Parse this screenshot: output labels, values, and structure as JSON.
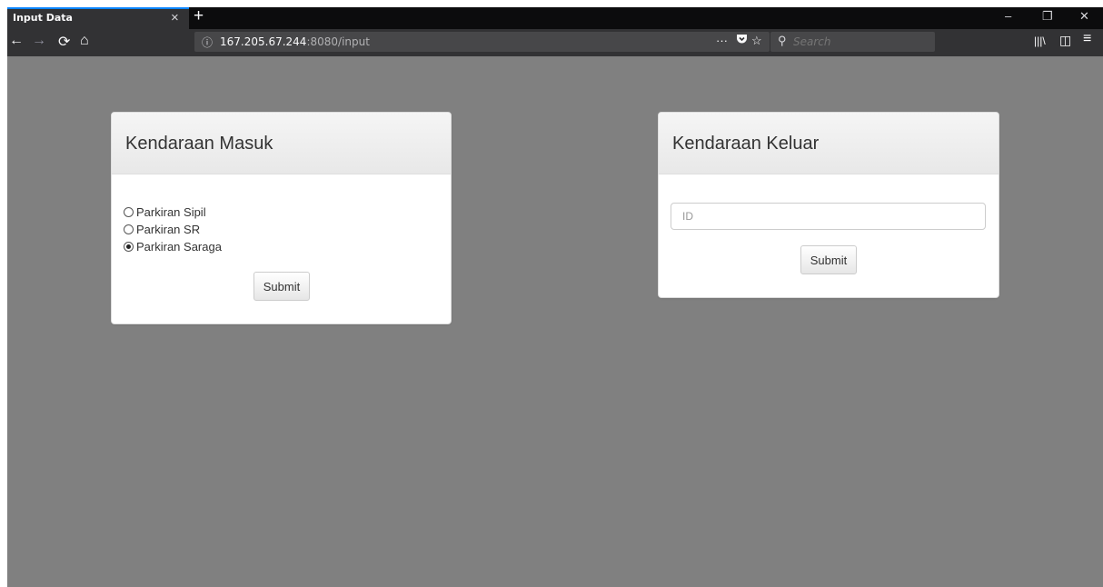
{
  "browser": {
    "tab_title": "Input Data",
    "tab_close": "×",
    "new_tab": "+",
    "window_controls": {
      "minimize": "–",
      "restore": "❐",
      "close": "✕"
    },
    "nav": {
      "back": "←",
      "forward": "→",
      "reload": "⟳",
      "home": "⌂"
    },
    "url": {
      "info_icon": "ⓘ",
      "host": "167.205.67.244",
      "path": ":8080/input"
    },
    "url_actions": {
      "more": "···",
      "pocket": "pocket-icon",
      "bookmark": "☆"
    },
    "search": {
      "icon": "⚲",
      "placeholder": "Search"
    },
    "toolbar": {
      "library": "|||\\",
      "sidebar": "◫",
      "menu": "≡"
    }
  },
  "page": {
    "background": "#808080",
    "panel_in": {
      "title": "Kendaraan Masuk",
      "options": [
        {
          "label": "Parkiran Sipil",
          "checked": false
        },
        {
          "label": "Parkiran SR",
          "checked": false
        },
        {
          "label": "Parkiran Saraga",
          "checked": true
        }
      ],
      "submit_label": "Submit"
    },
    "panel_out": {
      "title": "Kendaraan Keluar",
      "id_placeholder": "ID",
      "id_value": "",
      "submit_label": "Submit"
    }
  }
}
